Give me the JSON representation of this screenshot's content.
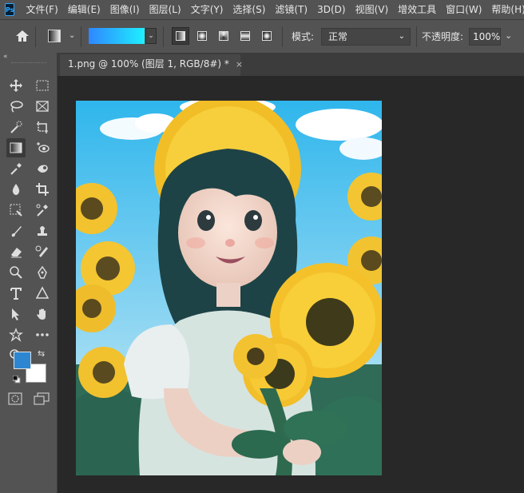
{
  "app": {
    "logo_text": "Ps"
  },
  "menu": [
    {
      "label": "文件(F)",
      "name": "menu-file"
    },
    {
      "label": "编辑(E)",
      "name": "menu-edit"
    },
    {
      "label": "图像(I)",
      "name": "menu-image"
    },
    {
      "label": "图层(L)",
      "name": "menu-layer"
    },
    {
      "label": "文字(Y)",
      "name": "menu-type"
    },
    {
      "label": "选择(S)",
      "name": "menu-select"
    },
    {
      "label": "滤镜(T)",
      "name": "menu-filter"
    },
    {
      "label": "3D(D)",
      "name": "menu-3d"
    },
    {
      "label": "视图(V)",
      "name": "menu-view"
    },
    {
      "label": "增效工具",
      "name": "menu-plugins"
    },
    {
      "label": "窗口(W)",
      "name": "menu-window"
    },
    {
      "label": "帮助(H)",
      "name": "menu-help"
    }
  ],
  "options": {
    "gradient_colors": [
      "#2f86ff",
      "#1ef0ff"
    ],
    "gradient_types": [
      "linear-gradient-icon",
      "radial-gradient-icon",
      "angle-gradient-icon",
      "reflected-gradient-icon",
      "diamond-gradient-icon"
    ],
    "mode_label": "模式:",
    "mode_value": "正常",
    "opacity_label": "不透明度:",
    "opacity_value": "100%"
  },
  "toolbar": {
    "collapse_icon": "«",
    "tools": [
      "move-icon",
      "rect-marquee-icon",
      "lasso-icon",
      "frame-icon",
      "quick-select-icon",
      "crop-perspective-icon",
      "gradient-icon",
      "eye-3d-icon",
      "eyedropper-icon",
      "patch-icon",
      "blur-drop-icon",
      "crop-icon",
      "content-aware-move-icon",
      "color-sampler-icon",
      "brush-icon",
      "stamp-icon",
      "eraser-icon",
      "history-brush-icon",
      "dodge-icon",
      "pen-icon",
      "type-icon",
      "triangle-shape-icon",
      "path-select-icon",
      "hand-icon",
      "custom-shape-icon",
      "more-tools-icon",
      "zoom-icon"
    ],
    "foreground_color": "#2d86d2",
    "background_color": "#ffffff"
  },
  "document": {
    "tab_title": "1.png @ 100% (图层 1, RGB/8#) *",
    "close_glyph": "×"
  }
}
